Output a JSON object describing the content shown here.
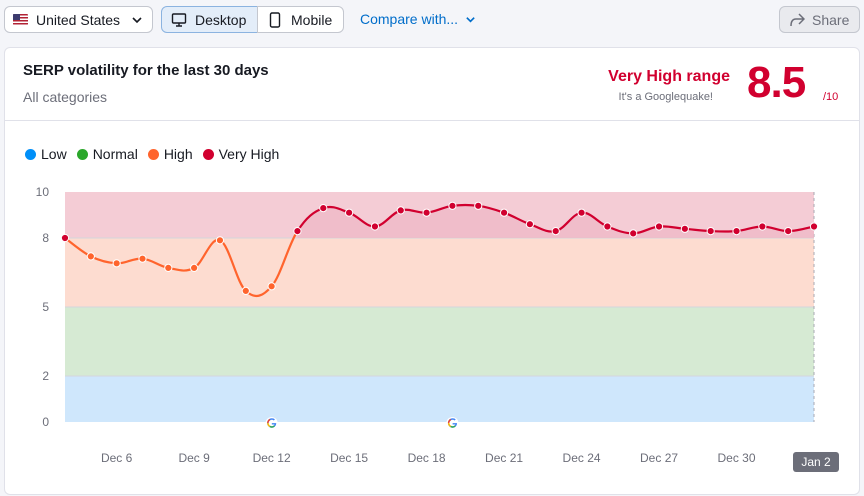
{
  "toolbar": {
    "country": "United States",
    "desktop": "Desktop",
    "mobile": "Mobile",
    "compare": "Compare with...",
    "share": "Share"
  },
  "card": {
    "title": "SERP volatility for the last 30 days",
    "subtitle": "All categories",
    "range_label": "Very High range",
    "range_sub": "It's a Googlequake!",
    "score": "8.5",
    "score_max": "/10"
  },
  "legend": [
    {
      "label": "Low",
      "color": "#008ff8"
    },
    {
      "label": "Normal",
      "color": "#2ba72b"
    },
    {
      "label": "High",
      "color": "#ff642d"
    },
    {
      "label": "Very High",
      "color": "#d1002f"
    }
  ],
  "chart_data": {
    "type": "line",
    "y_ticks": [
      0,
      2,
      5,
      8,
      10
    ],
    "ylim": [
      0,
      10
    ],
    "x_labels": [
      "Dec 6",
      "Dec 9",
      "Dec 12",
      "Dec 15",
      "Dec 18",
      "Dec 21",
      "Dec 24",
      "Dec 27",
      "Dec 30",
      "Jan 2"
    ],
    "x": [
      "Dec 4",
      "Dec 5",
      "Dec 6",
      "Dec 7",
      "Dec 8",
      "Dec 9",
      "Dec 10",
      "Dec 11",
      "Dec 12",
      "Dec 13",
      "Dec 14",
      "Dec 15",
      "Dec 16",
      "Dec 17",
      "Dec 18",
      "Dec 19",
      "Dec 20",
      "Dec 21",
      "Dec 22",
      "Dec 23",
      "Dec 24",
      "Dec 25",
      "Dec 26",
      "Dec 27",
      "Dec 28",
      "Dec 29",
      "Dec 30",
      "Dec 31",
      "Jan 1",
      "Jan 2"
    ],
    "values": [
      8.0,
      7.2,
      6.9,
      7.1,
      6.7,
      6.7,
      7.9,
      5.7,
      5.9,
      8.3,
      9.3,
      9.1,
      8.5,
      9.2,
      9.1,
      9.4,
      9.4,
      9.1,
      8.6,
      8.3,
      9.1,
      8.5,
      8.2,
      8.5,
      8.4,
      8.3,
      8.3,
      8.5,
      8.3,
      8.5
    ],
    "bands": [
      {
        "name": "Low",
        "from": 0,
        "to": 2,
        "color": "#cfe7fc"
      },
      {
        "name": "Normal",
        "from": 2,
        "to": 5,
        "color": "#d6ead3"
      },
      {
        "name": "High",
        "from": 5,
        "to": 8,
        "color": "#fddcd0"
      },
      {
        "name": "Very High",
        "from": 8,
        "to": 10,
        "color": "#f4ccd5"
      }
    ],
    "google_update_markers": [
      "Dec 12",
      "Dec 19"
    ],
    "high_color": "#ff642d",
    "very_high_color": "#d1002f"
  }
}
